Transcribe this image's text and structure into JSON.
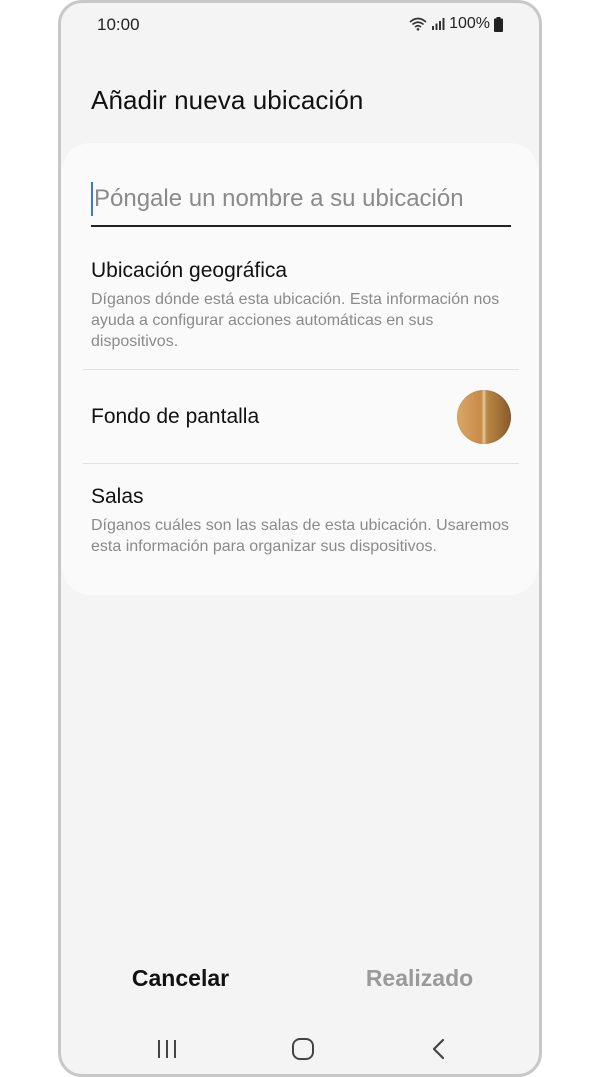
{
  "status_bar": {
    "time": "10:00",
    "battery": "100%",
    "icons": [
      "wifi-icon",
      "signal-icon",
      "battery-icon"
    ]
  },
  "header": {
    "title": "Añadir nueva ubicación"
  },
  "form": {
    "name_placeholder": "Póngale un nombre a su ubicación",
    "name_value": ""
  },
  "settings": {
    "geo": {
      "title": "Ubicación geográfica",
      "description": "Díganos dónde está esta ubicación. Esta información nos ayuda a configurar acciones automáticas en sus dispositivos."
    },
    "wallpaper": {
      "title": "Fondo de pantalla"
    },
    "rooms": {
      "title": "Salas",
      "description": "Díganos cuáles son las salas de esta ubicación. Usaremos esta información para organizar sus dispositivos."
    }
  },
  "actions": {
    "cancel_label": "Cancelar",
    "done_label": "Realizado"
  },
  "nav": {
    "icons": [
      "recent-apps-icon",
      "home-icon",
      "back-icon"
    ]
  },
  "colors": {
    "background": "#f4f4f4",
    "card": "#fafafa",
    "cursor": "#3e74d8",
    "disabled_text": "#9a9a9a"
  }
}
